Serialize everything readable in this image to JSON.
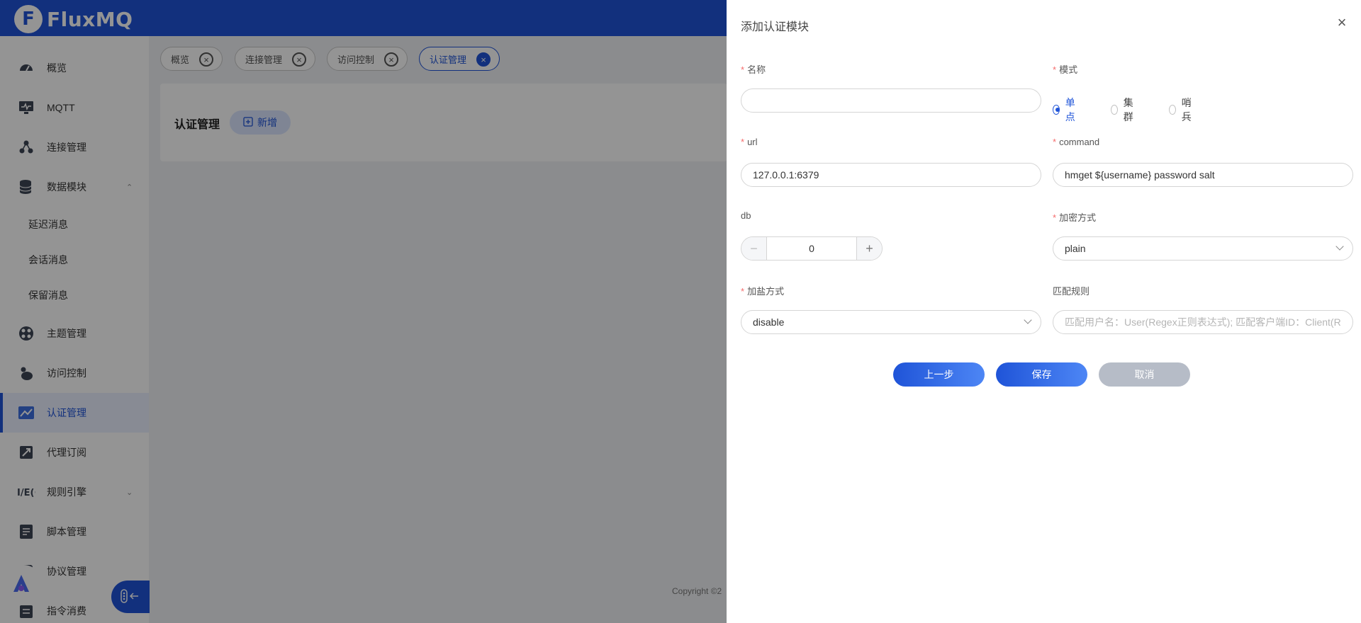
{
  "app": {
    "logo_letter": "F",
    "logo_text": "FluxMQ"
  },
  "sidebar": {
    "items": [
      {
        "label": "概览",
        "icon": "dashboard-icon"
      },
      {
        "label": "MQTT",
        "icon": "monitor-icon"
      },
      {
        "label": "连接管理",
        "icon": "connection-icon"
      },
      {
        "label": "数据模块",
        "icon": "database-icon",
        "expanded": true
      },
      {
        "label": "延迟消息",
        "sub": true
      },
      {
        "label": "会话消息",
        "sub": true
      },
      {
        "label": "保留消息",
        "sub": true
      },
      {
        "label": "主题管理",
        "icon": "topic-icon"
      },
      {
        "label": "访问控制",
        "icon": "access-icon"
      },
      {
        "label": "认证管理",
        "icon": "auth-icon",
        "active": true
      },
      {
        "label": "代理订阅",
        "icon": "proxy-icon"
      },
      {
        "label": "规则引擎",
        "icon": "rules-icon",
        "collapsed": true
      },
      {
        "label": "脚本管理",
        "icon": "script-icon"
      },
      {
        "label": "协议管理",
        "icon": "protocol-icon"
      },
      {
        "label": "指令消费",
        "icon": "command-icon"
      }
    ],
    "arrow_up": "⌃",
    "arrow_down": "⌄"
  },
  "tabs": [
    {
      "label": "概览",
      "active": false
    },
    {
      "label": "连接管理",
      "active": false
    },
    {
      "label": "访问控制",
      "active": false
    },
    {
      "label": "认证管理",
      "active": true
    }
  ],
  "main": {
    "title": "认证管理",
    "add_label": "新增",
    "copyright": "Copyright ©2"
  },
  "drawer": {
    "title": "添加认证模块",
    "close": "×",
    "fields": {
      "name": {
        "label": "名称",
        "value": ""
      },
      "mode": {
        "label": "模式",
        "options": [
          "单点",
          "集群",
          "哨兵"
        ],
        "selected": "单点"
      },
      "url": {
        "label": "url",
        "value": "127.0.0.1:6379"
      },
      "command": {
        "label": "command",
        "value": "hmget ${username} password salt"
      },
      "db": {
        "label": "db",
        "value": "0",
        "minus": "−",
        "plus": "+"
      },
      "encryption": {
        "label": "加密方式",
        "value": "plain"
      },
      "salt": {
        "label": "加盐方式",
        "value": "disable"
      },
      "match": {
        "label": "匹配规则",
        "placeholder": "匹配用户名：User(Regex正则表达式); 匹配客户端ID：Client(Regex正则表达式)"
      }
    },
    "buttons": {
      "prev": "上一步",
      "save": "保存",
      "cancel": "取消"
    }
  },
  "colors": {
    "primary": "#1f54d8",
    "required": "#f56c6c",
    "cancel": "#b6bcc7"
  }
}
